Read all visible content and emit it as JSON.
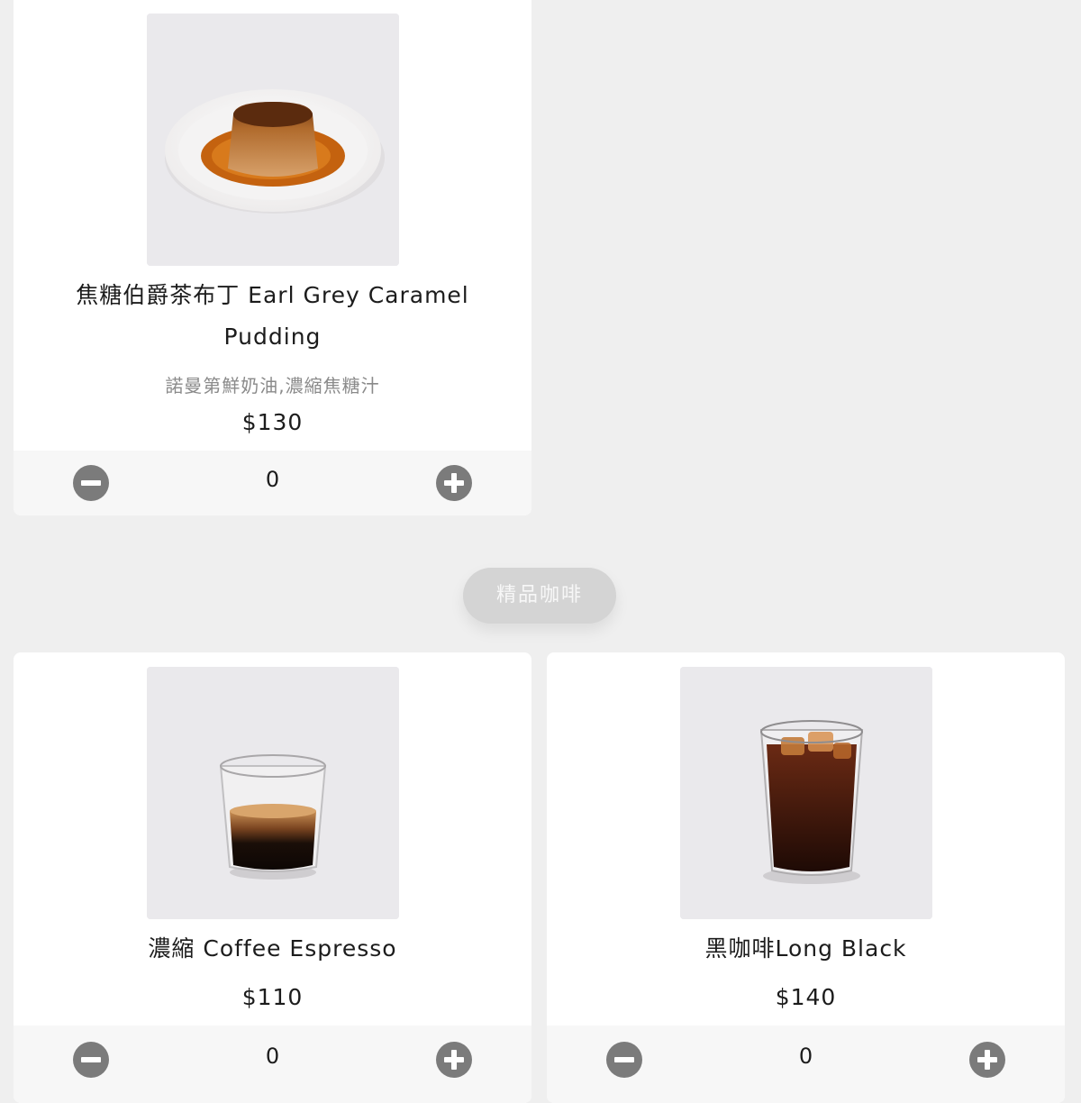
{
  "category_pill": {
    "label": "精品咖啡"
  },
  "products": [
    {
      "title_line1": "焦糖伯爵茶布丁 Earl Grey Caramel",
      "title_line2": "Pudding",
      "description": "諾曼第鮮奶油,濃縮焦糖汁",
      "price": "$130",
      "quantity": "0",
      "image_icon": "caramel-pudding-photo"
    },
    {
      "title_line1": "濃縮 Coffee Espresso",
      "price": "$110",
      "quantity": "0",
      "image_icon": "espresso-glass-photo"
    },
    {
      "title_line1": "黑咖啡Long Black",
      "price": "$140",
      "quantity": "0",
      "image_icon": "iced-long-black-photo"
    }
  ],
  "colors": {
    "page_bg": "#efefef",
    "card_bg": "#ffffff",
    "stepper_icon": "#7b7b7b",
    "pill_bg": "#d4d4d4"
  }
}
